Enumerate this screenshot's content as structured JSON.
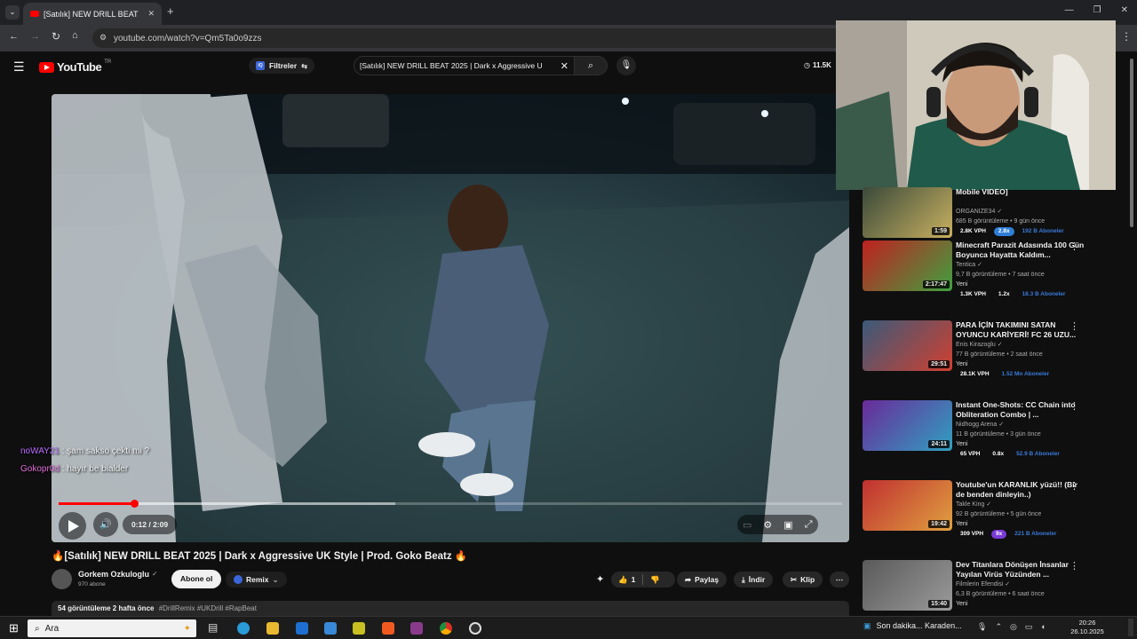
{
  "browser": {
    "tab_title": "[Satılık] NEW DRILL BEAT",
    "url": "youtube.com/watch?v=Qm5Ta0o9zzs"
  },
  "yt": {
    "logo": "YouTube",
    "region": "TR",
    "filters": "Filtreler",
    "search_value": "[Satılık] NEW DRILL BEAT 2025 | Dark x Aggressive U",
    "counter": "11.5K"
  },
  "player": {
    "time": "0:12 / 2:09",
    "progress": 0.096,
    "buffered": 0.43
  },
  "chat": [
    {
      "user": "noWAY21",
      "text": " : şam sakso çekti mi ?",
      "color": "#b86bff"
    },
    {
      "user": "Gokopr0d",
      "text": " : hayır be bialder",
      "color": "#e06bd8"
    }
  ],
  "video": {
    "title": "🔥[Satılık] NEW DRILL BEAT 2025 | Dark x Aggressive UK Style | Prod. Goko Beatz 🔥",
    "channel": "Gorkem Ozkuloglu",
    "subs": "970 abone",
    "subscribe": "Abone ol",
    "remix": "Remix",
    "likes": "1",
    "share": "Paylaş",
    "download": "İndir",
    "clip": "Klip",
    "stats": "54 görüntüleme  2 hafta önce",
    "tags": "#DrillRemix #UKDrill #RapBeat"
  },
  "suggestions": [
    {
      "title": "Mobile VIDEO]",
      "channel": "ORGANIZE34",
      "meta": "685 B görüntüleme • 9 gün önce",
      "new": "",
      "vph": "2.8K VPH",
      "mult": "2.8x",
      "mult_color": "#2f7fd8",
      "subs": "192 B Aboneler",
      "duration": "1:59",
      "colors": [
        "#3a4a3a",
        "#c8b060"
      ]
    },
    {
      "title": "Minecraft Parazit Adasında 100 Gün Boyunca Hayatta Kaldım...",
      "channel": "Tentica",
      "meta": "9,7 B görüntüleme • 7 saat önce",
      "new": "Yeni",
      "vph": "1.3K VPH",
      "mult": "1.2x",
      "mult_color": "",
      "subs": "18.3 B Aboneler",
      "duration": "2:17:47",
      "colors": [
        "#c02020",
        "#40a040"
      ]
    },
    {
      "title": "PARA İÇİN TAKIMINI SATAN OYUNCU KARİYERİ! FC 26 UZU...",
      "channel": "Enis Kirazoglu",
      "meta": "77 B görüntüleme • 2 saat önce",
      "new": "Yeni",
      "vph": "28.1K VPH",
      "mult": "",
      "mult_color": "",
      "subs": "1.52 Mn Aboneler",
      "duration": "29:51",
      "colors": [
        "#3a5a7a",
        "#d04030"
      ]
    },
    {
      "title": "Instant One-Shots: CC Chain into Obliteration Combo | ...",
      "channel": "Nidhogg Arena",
      "meta": "11 B görüntüleme • 3 gün önce",
      "new": "Yeni",
      "vph": "65 VPH",
      "mult": "0.8x",
      "mult_color": "",
      "subs": "52.9 B Aboneler",
      "duration": "24:11",
      "colors": [
        "#6a2a9a",
        "#30a0c0"
      ]
    },
    {
      "title": "Youtube'un KARANLIK yüzü!! (Bir de benden dinleyin..)",
      "channel": "Takle King",
      "meta": "92 B görüntüleme • 5 gün önce",
      "new": "Yeni",
      "vph": "309 VPH",
      "mult": "9x",
      "mult_color": "#7a3ad8",
      "subs": "221 B Aboneler",
      "duration": "19:42",
      "colors": [
        "#c03030",
        "#e0a040"
      ]
    },
    {
      "title": "Dev Titanlara Dönüşen İnsanlar Yayılan Virüs Yüzünden ...",
      "channel": "Filmlerin Efendisi",
      "meta": "6,3 B görüntüleme • 6 saat önce",
      "new": "Yeni",
      "vph": "",
      "mult": "",
      "mult_color": "",
      "subs": "",
      "duration": "15:40",
      "colors": [
        "#5a5a5a",
        "#9a9a9a"
      ]
    }
  ],
  "taskbar": {
    "search": "Ara",
    "weather": "Son dakika... Karaden...",
    "time": "20:26",
    "date": "26.10.2025"
  }
}
